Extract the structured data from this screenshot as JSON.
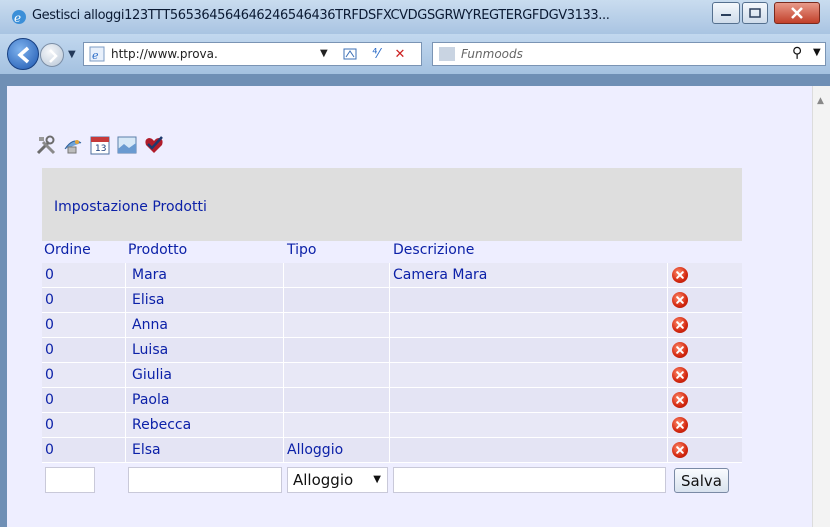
{
  "window": {
    "title": "Gestisci alloggi123TTT565364564646246546436TRFDSFXCVDGSGRWYREGTERGFDGV3133..."
  },
  "navbar": {
    "address": "http://www.prova.",
    "search_placeholder": "Funmoods"
  },
  "toolbar": {
    "icons": [
      "tools-icon",
      "satellite-icon",
      "calendar-icon",
      "image-icon",
      "heart-check-icon"
    ]
  },
  "panel": {
    "title": "Impostazione Prodotti"
  },
  "table": {
    "headers": [
      "Ordine",
      "Prodotto",
      "Tipo",
      "Descrizione"
    ],
    "rows": [
      {
        "ordine": "0",
        "prodotto": "Mara",
        "tipo": "",
        "descrizione": "Camera Mara"
      },
      {
        "ordine": "0",
        "prodotto": "Elisa",
        "tipo": "",
        "descrizione": ""
      },
      {
        "ordine": "0",
        "prodotto": "Anna",
        "tipo": "",
        "descrizione": ""
      },
      {
        "ordine": "0",
        "prodotto": "Luisa",
        "tipo": "",
        "descrizione": ""
      },
      {
        "ordine": "0",
        "prodotto": "Giulia",
        "tipo": "",
        "descrizione": ""
      },
      {
        "ordine": "0",
        "prodotto": "Paola",
        "tipo": "",
        "descrizione": ""
      },
      {
        "ordine": "0",
        "prodotto": "Rebecca",
        "tipo": "",
        "descrizione": ""
      },
      {
        "ordine": "0",
        "prodotto": "Elsa",
        "tipo": "Alloggio",
        "descrizione": ""
      }
    ]
  },
  "new_row": {
    "ordine_value": "",
    "prodotto_value": "",
    "tipo_selected": "Alloggio",
    "descrizione_value": "",
    "save_label": "Salva"
  },
  "colors": {
    "link_blue": "#0c21a8",
    "page_bg": "#eeeeff",
    "header_bg": "#dedede",
    "delete_red": "#d2260e"
  }
}
